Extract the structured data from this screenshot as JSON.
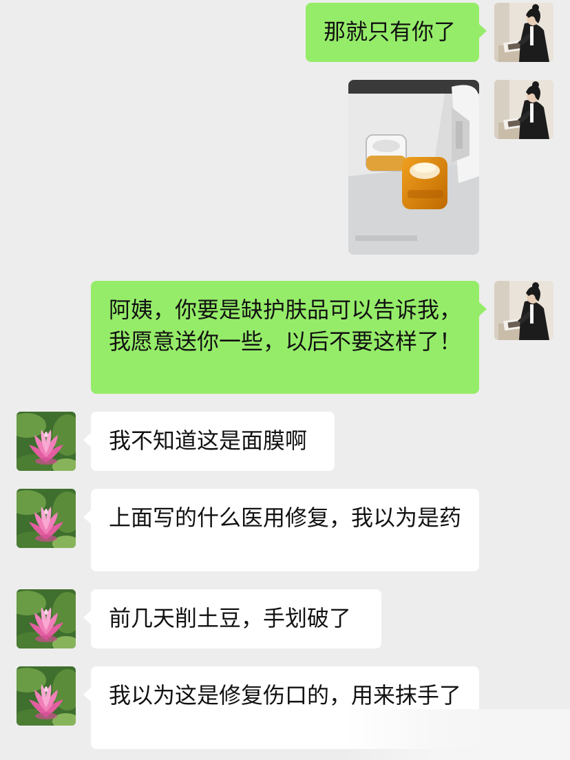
{
  "conversation": {
    "messages": [
      {
        "sender": "me",
        "type": "text",
        "text": "那就只有你了"
      },
      {
        "sender": "me",
        "type": "image",
        "image_icon": "skincare-jars-photo"
      },
      {
        "sender": "me",
        "type": "text",
        "text": "阿姨，你要是缺护肤品可以告诉我，我愿意送你一些，以后不要这样了！"
      },
      {
        "sender": "them",
        "type": "text",
        "text": "我不知道这是面膜啊"
      },
      {
        "sender": "them",
        "type": "text",
        "text": "上面写的什么医用修复，我以为是药"
      },
      {
        "sender": "them",
        "type": "text",
        "text": "前几天削土豆，手划破了"
      },
      {
        "sender": "them",
        "type": "text",
        "text": "我以为这是修复伤口的，用来抹手了"
      }
    ]
  },
  "colors": {
    "background": "#ededed",
    "my_bubble": "#95ec69",
    "their_bubble": "#ffffff",
    "text": "#111111"
  },
  "avatars": {
    "me": "woman-reading-avatar",
    "them": "pink-lotus-avatar"
  }
}
